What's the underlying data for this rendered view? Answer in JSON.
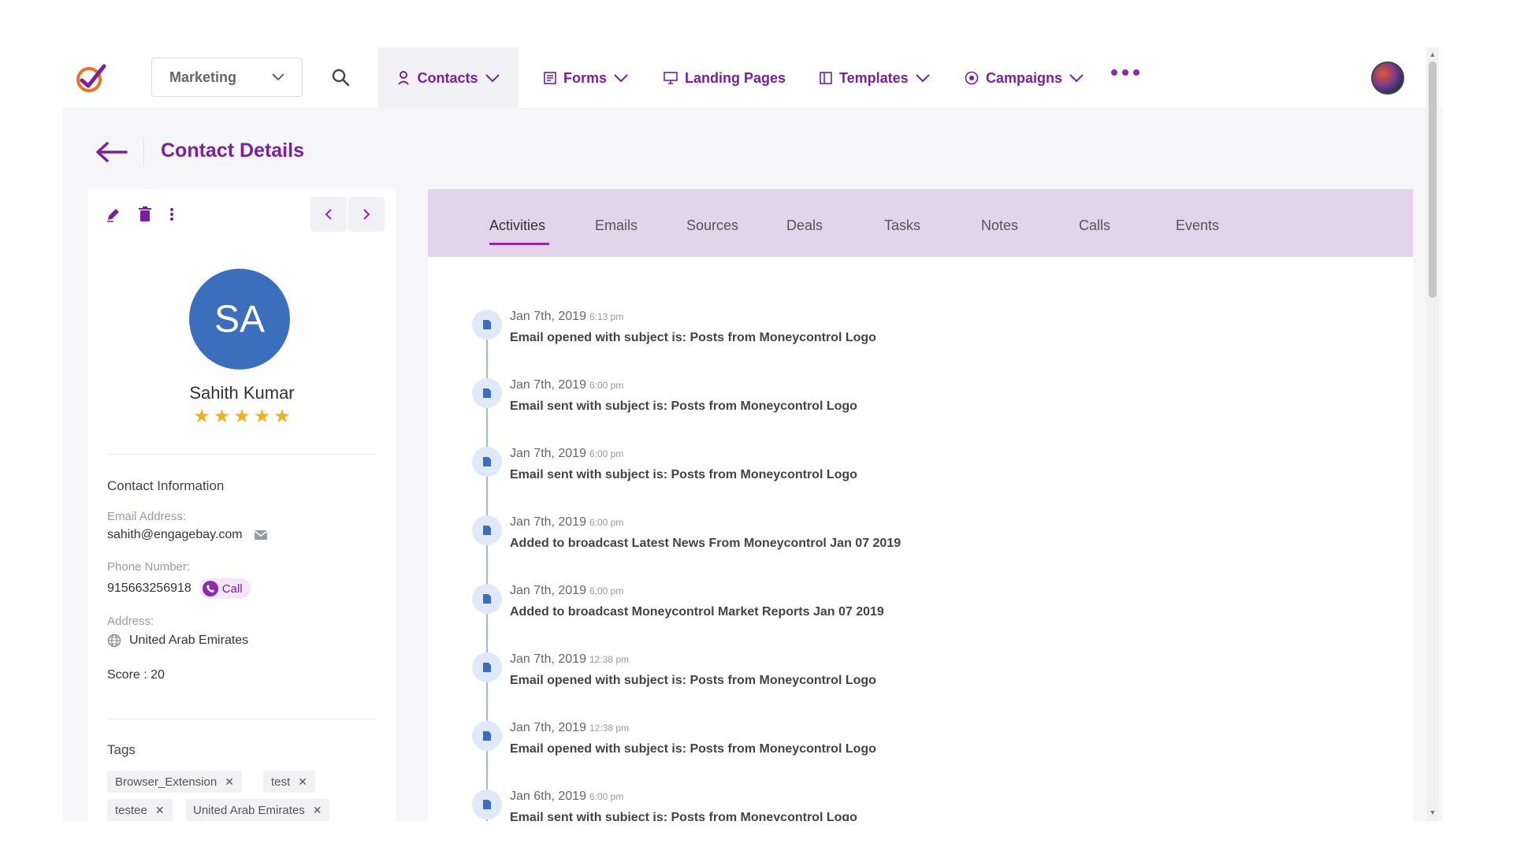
{
  "nav": {
    "workspace": "Marketing",
    "items": [
      {
        "label": "Contacts",
        "icon": "person-icon"
      },
      {
        "label": "Forms",
        "icon": "form-icon"
      },
      {
        "label": "Landing Pages",
        "icon": "monitor-icon"
      },
      {
        "label": "Templates",
        "icon": "template-icon"
      },
      {
        "label": "Campaigns",
        "icon": "campaign-icon"
      }
    ]
  },
  "header": {
    "title": "Contact Details"
  },
  "contact": {
    "initials": "SA",
    "name": "Sahith Kumar",
    "rating": 5,
    "info_title": "Contact Information",
    "email_label": "Email Address:",
    "email": "sahith@engagebay.com",
    "phone_label": "Phone Number:",
    "phone": "915663256918",
    "call_label": "Call",
    "address_label": "Address:",
    "address": "United Arab Emirates",
    "score": "Score : 20",
    "tags_title": "Tags",
    "tags": [
      "Browser_Extension",
      "test",
      "testee",
      "United Arab Emirates"
    ]
  },
  "tabs": [
    "Activities",
    "Emails",
    "Sources",
    "Deals",
    "Tasks",
    "Notes",
    "Calls",
    "Events"
  ],
  "activities": [
    {
      "date": "Jan 7th, 2019",
      "time": "6:13 pm",
      "text": "Email opened with subject is: Posts from Moneycontrol Logo"
    },
    {
      "date": "Jan 7th, 2019",
      "time": "6:00 pm",
      "text": "Email sent with subject is: Posts from Moneycontrol Logo"
    },
    {
      "date": "Jan 7th, 2019",
      "time": "6:00 pm",
      "text": "Email sent with subject is: Posts from Moneycontrol Logo"
    },
    {
      "date": "Jan 7th, 2019",
      "time": "6:00 pm",
      "text": "Added to broadcast Latest News From Moneycontrol Jan 07 2019"
    },
    {
      "date": "Jan 7th, 2019",
      "time": "6:00 pm",
      "text": "Added to broadcast Moneycontrol Market Reports Jan 07 2019"
    },
    {
      "date": "Jan 7th, 2019",
      "time": "12:38 pm",
      "text": "Email opened with subject is: Posts from Moneycontrol Logo"
    },
    {
      "date": "Jan 7th, 2019",
      "time": "12:38 pm",
      "text": "Email opened with subject is: Posts from Moneycontrol Logo"
    },
    {
      "date": "Jan 6th, 2019",
      "time": "6:00 pm",
      "text": "Email sent with subject is: Posts from Moneycontrol Logo"
    }
  ],
  "colors": {
    "brand": "#7b1f9e",
    "tabbar": "#e3d3eb",
    "avatar": "#3b6fbe",
    "star": "#f2b01e"
  }
}
